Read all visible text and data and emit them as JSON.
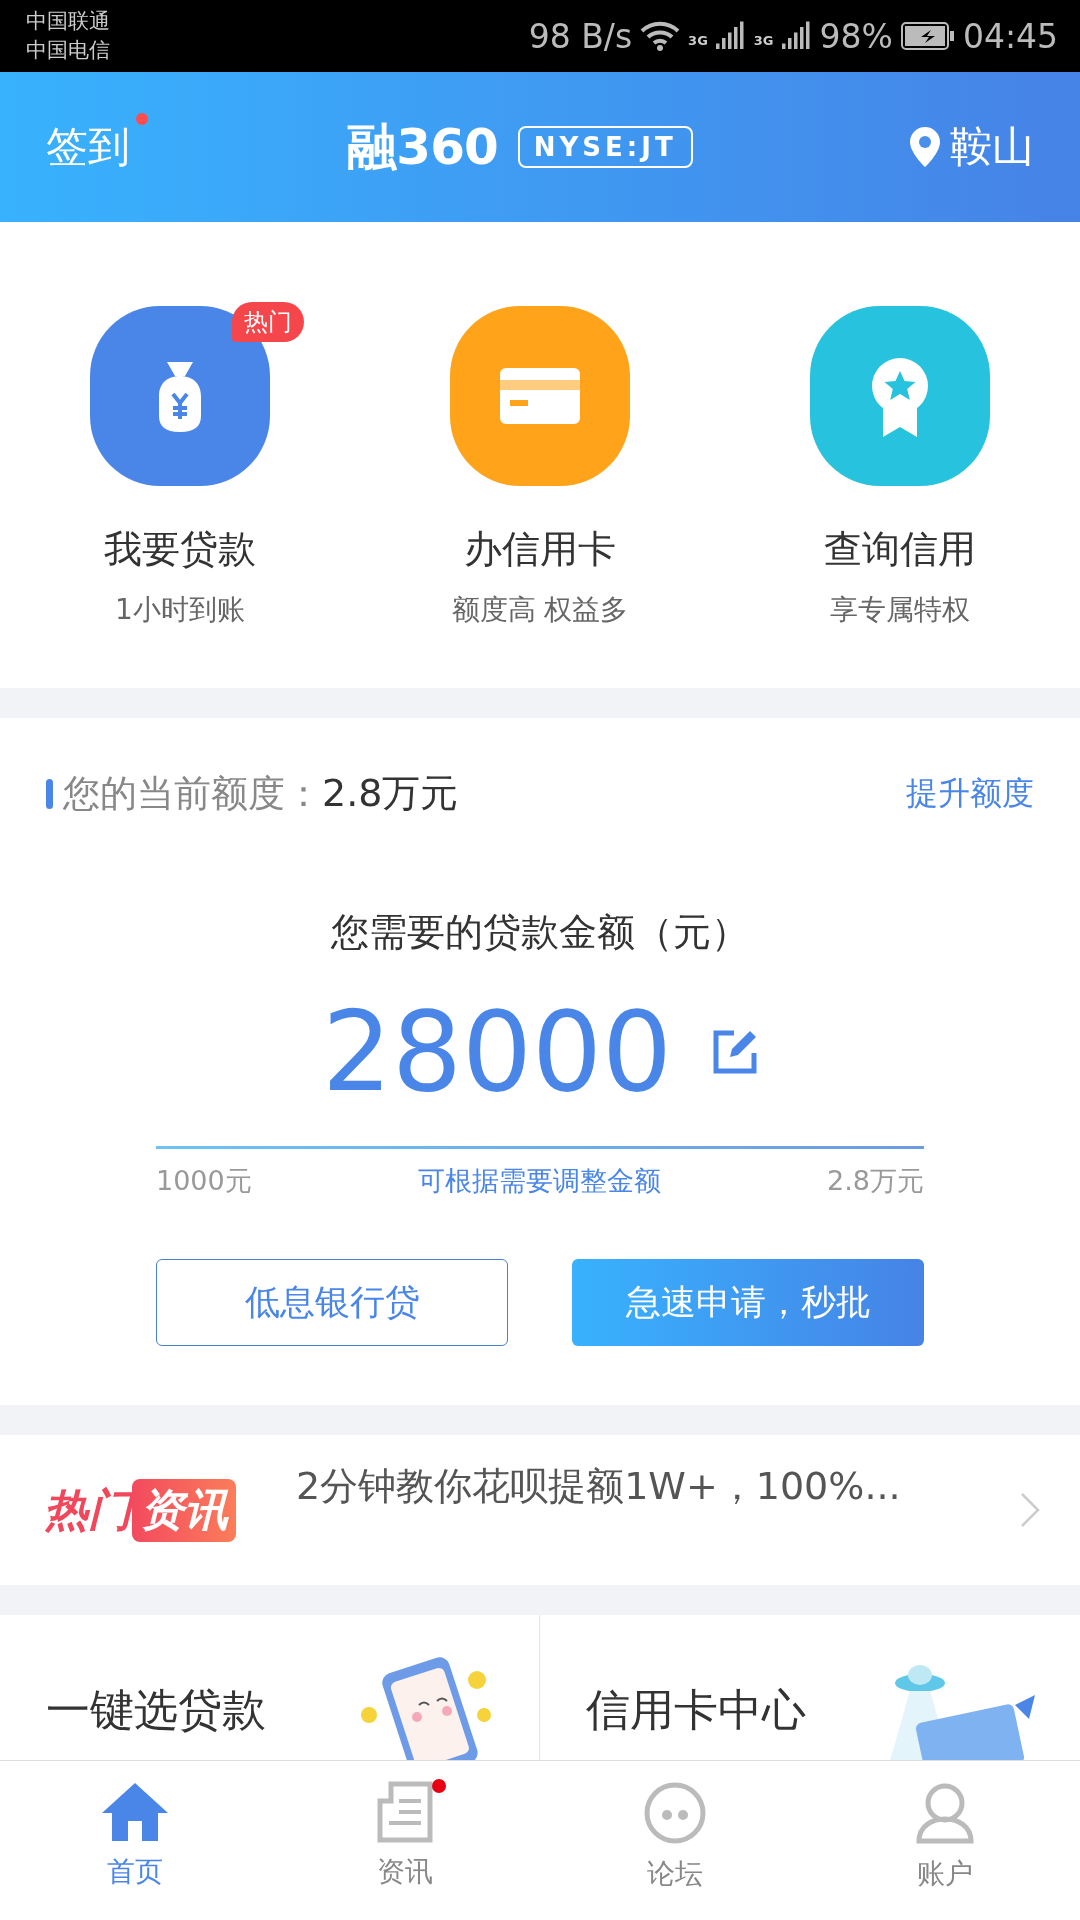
{
  "status_bar": {
    "carriers": [
      "中国联通",
      "中国电信"
    ],
    "speed": "98 B/s",
    "networks": [
      "3G",
      "3G"
    ],
    "battery": "98%",
    "time": "04:45"
  },
  "header": {
    "checkin": {
      "label": "签到",
      "dot": true
    },
    "logo": "融360",
    "ticker": "NYSE:JT",
    "location": "鞍山"
  },
  "services": [
    {
      "kind": "loan",
      "title": "我要贷款",
      "subtitle": "1小时到账",
      "color": "#4a86e8",
      "badge": "热门"
    },
    {
      "kind": "card",
      "title": "办信用卡",
      "subtitle": "额度高 权益多",
      "color": "#ffa31a"
    },
    {
      "kind": "credit",
      "title": "查询信用",
      "subtitle": "享专属特权",
      "color": "#27c2dd"
    }
  ],
  "quota": {
    "label": "您的当前额度：",
    "value": "2.8万元",
    "action": "提升额度"
  },
  "loan": {
    "title": "您需要的贷款金额（元）",
    "amount": "28000",
    "level": 1,
    "min": "1000元",
    "hint": "可根据需要调整金额",
    "max": "2.8万元"
  },
  "buttons": [
    {
      "kind": "outline",
      "label": "低息银行贷"
    },
    {
      "kind": "filled",
      "label": "急速申请，秒批"
    }
  ],
  "news": {
    "tag_parts": [
      "热门",
      "资讯"
    ],
    "headline": "2分钟教你花呗提额1W+，100%..."
  },
  "promo_cards": [
    {
      "kind": "phone",
      "title": "一键选贷款"
    },
    {
      "kind": "ufo",
      "title": "信用卡中心"
    }
  ],
  "tabs": [
    {
      "kind": "home",
      "label": "首页",
      "selected": true,
      "dot": false
    },
    {
      "kind": "news",
      "label": "资讯",
      "selected": false,
      "dot": true
    },
    {
      "kind": "forum",
      "label": "论坛",
      "selected": false,
      "dot": false
    },
    {
      "kind": "account",
      "label": "账户",
      "selected": false,
      "dot": false
    }
  ]
}
